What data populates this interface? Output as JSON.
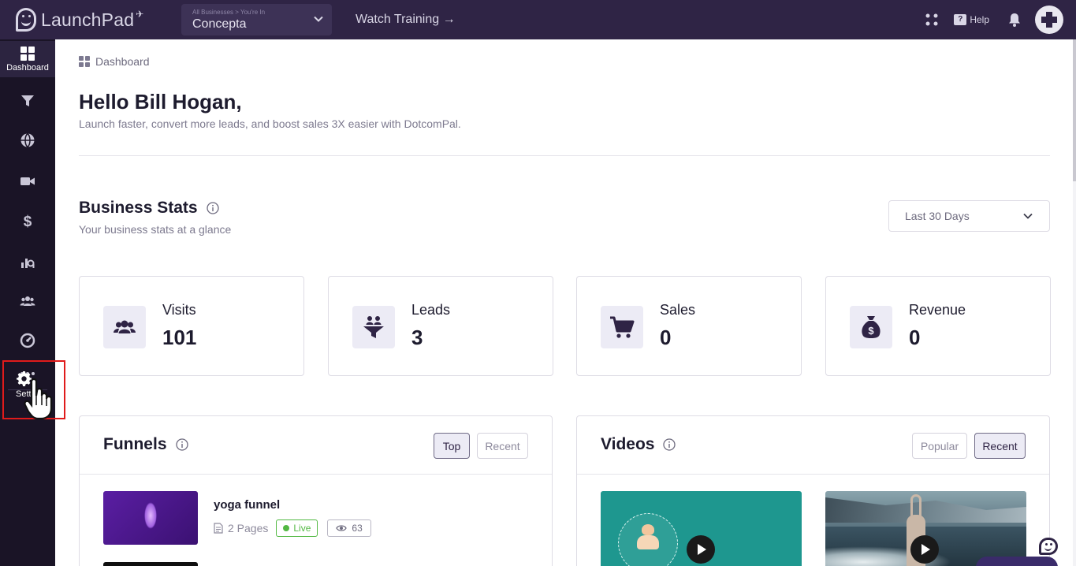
{
  "topbar": {
    "logo_text": "LaunchPad",
    "business_caption": "All Businesses > You're In",
    "business_name": "Concepta",
    "watch_training": "Watch Training →",
    "help_label": "Help",
    "help_glyph": "?"
  },
  "sidebar": {
    "active_label": "Dashboard",
    "settings_label": "Setti",
    "items": [
      "dashboard-icon",
      "funnel-icon",
      "globe-icon",
      "video-icon",
      "dollar-icon",
      "chart-icon",
      "users-icon",
      "speedometer-icon",
      "more-icon"
    ]
  },
  "breadcrumb": {
    "label": "Dashboard"
  },
  "greeting": {
    "title": "Hello Bill Hogan,",
    "subtitle": "Launch faster, convert more leads, and boost sales 3X easier with DotcomPal."
  },
  "business_stats": {
    "title": "Business Stats",
    "subtitle": "Your business stats at a glance",
    "range": "Last 30 Days",
    "cards": [
      {
        "label": "Visits",
        "value": "101",
        "icon": "users-icon"
      },
      {
        "label": "Leads",
        "value": "3",
        "icon": "funnel-people-icon"
      },
      {
        "label": "Sales",
        "value": "0",
        "icon": "cart-icon"
      },
      {
        "label": "Revenue",
        "value": "0",
        "icon": "money-bag-icon"
      }
    ]
  },
  "funnels": {
    "title": "Funnels",
    "tab_top": "Top",
    "tab_recent": "Recent",
    "items": [
      {
        "name": "yoga funnel",
        "pages": "2 Pages",
        "status": "Live",
        "views": "63"
      }
    ]
  },
  "videos": {
    "title": "Videos",
    "tab_popular": "Popular",
    "tab_recent": "Recent"
  },
  "colors": {
    "topbar": "#2f2445",
    "sidebar": "#1a1426",
    "live": "#52b842",
    "highlight": "#e01b1b"
  }
}
